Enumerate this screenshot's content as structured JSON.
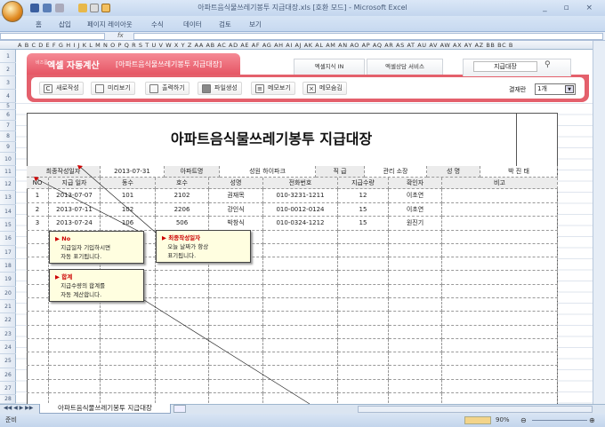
{
  "window": {
    "title": "아파트음식물쓰레기봉투 지급대장.xls [호환 모드] - Microsoft Excel",
    "controls": "_ ▫ ×"
  },
  "ribbon_tabs": [
    "홈",
    "삽입",
    "페이지 레이아웃",
    "수식",
    "데이터",
    "검토",
    "보기"
  ],
  "formula_bar": {
    "fx": "fx",
    "name_box": ""
  },
  "columns": "A B C D E F G H I J K L M N O P Q R S T U V W X Y Z AA AB AC AD AE AF AG AH AI AJ AK AL AM AN AO AP AQ AR AS AT AU AV AW AX AY AZ BB BC B",
  "rows": [
    "1",
    "2",
    "3",
    "4",
    "5",
    "6",
    "7",
    "8",
    "9",
    "10",
    "11",
    "12",
    "13",
    "14",
    "15",
    "16",
    "17",
    "18",
    "19",
    "20",
    "21",
    "22",
    "23",
    "24",
    "25",
    "26",
    "27",
    "28"
  ],
  "banner": {
    "brand_small": "비즈폼",
    "brand": "엑셀 자동계산",
    "subtitle": "[아파트음식물쓰레기봉투 지급대장]",
    "tab1": "엑셀지식 IN",
    "tab2": "엑셀상담 서비스",
    "search_value": "지급대장"
  },
  "toolbar": {
    "new": "새로작성",
    "preview": "미리보기",
    "print": "출력하기",
    "file": "파일생성",
    "memo_show": "메모보기",
    "memo_hide": "메모숨김",
    "result_label": "결재란",
    "result_value": "1개"
  },
  "doc": {
    "title": "아파트음식물쓰레기봉투 지급대장",
    "info": {
      "date_label": "최종작성일자",
      "date": "2013-07-31",
      "apt_label": "아파트명",
      "apt": "성원 하이파크",
      "rank_label": "직 급",
      "rank": "관리 소장",
      "name_label": "성 명",
      "name": "박 진 태"
    },
    "headers": [
      "NO",
      "지급 일자",
      "동수",
      "호수",
      "성명",
      "전화번호",
      "지급수량",
      "확인자",
      "비고"
    ],
    "rows": [
      [
        "1",
        "2013-07-07",
        "101",
        "2102",
        "권재목",
        "010-3231-1211",
        "12",
        "이초연",
        ""
      ],
      [
        "2",
        "2013-07-11",
        "102",
        "2206",
        "강인식",
        "010-0012-0124",
        "15",
        "이초연",
        ""
      ],
      [
        "3",
        "2013-07-24",
        "106",
        "506",
        "박창식",
        "010-0324-1212",
        "15",
        "원진기",
        ""
      ]
    ]
  },
  "notes": [
    {
      "title": "No",
      "line1": "지급일자 기입하시면",
      "line2": "자동 표기됩니다."
    },
    {
      "title": "최종작성일자",
      "line1": "오늘 날짜가 항상",
      "line2": "표기됩니다."
    },
    {
      "title": "합계",
      "line1": "지급수량의 합계를",
      "line2": "자동 계산합니다."
    }
  ],
  "sheet_tab": "아파트음식물쓰레기봉투 지급대장",
  "status": {
    "ready": "준비",
    "zoom": "90%"
  }
}
